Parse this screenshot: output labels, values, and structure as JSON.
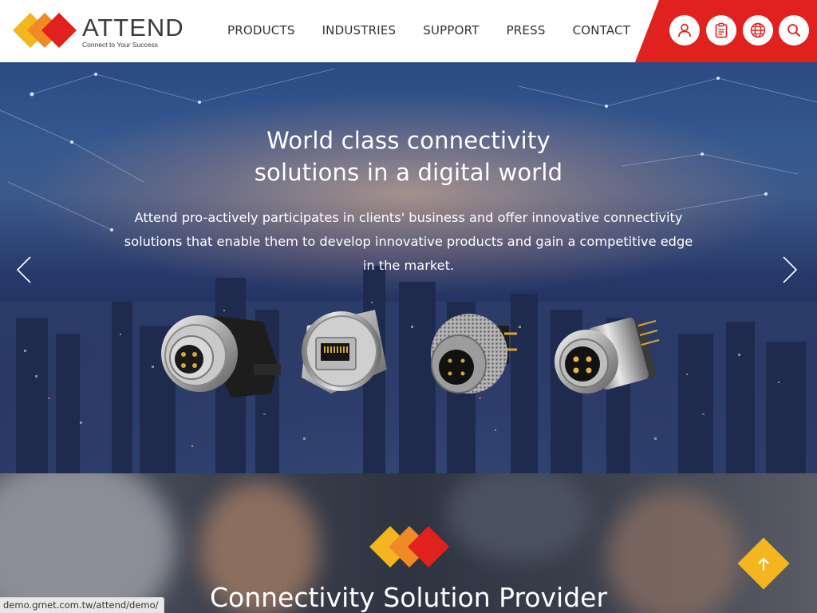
{
  "brand": {
    "name": "ATTEND",
    "tagline": "Connect to Your Success",
    "colors": {
      "red": "#e0211d",
      "orange": "#f08a24",
      "yellow": "#f3b61f"
    }
  },
  "nav": {
    "items": [
      {
        "label": "PRODUCTS"
      },
      {
        "label": "INDUSTRIES"
      },
      {
        "label": "SUPPORT"
      },
      {
        "label": "PRESS"
      },
      {
        "label": "CONTACT"
      }
    ]
  },
  "header_icons": [
    "user-icon",
    "clipboard-icon",
    "globe-icon",
    "search-icon"
  ],
  "hero": {
    "title_line1": "World class connectivity",
    "title_line2": "solutions in a digital world",
    "description_line1": "Attend pro-actively participates in clients' business and offer innovative connectivity",
    "description_line2": "solutions that enable them to develop innovative products and gain a competitive edge",
    "description_line3": "in the market.",
    "prev_icon": "chevron-left-icon",
    "next_icon": "chevron-right-icon"
  },
  "section2": {
    "title": "Connectivity Solution Provider",
    "back_to_top_icon": "arrow-up-icon"
  },
  "status_bar": {
    "url": "demo.grnet.com.tw/attend/demo/"
  }
}
